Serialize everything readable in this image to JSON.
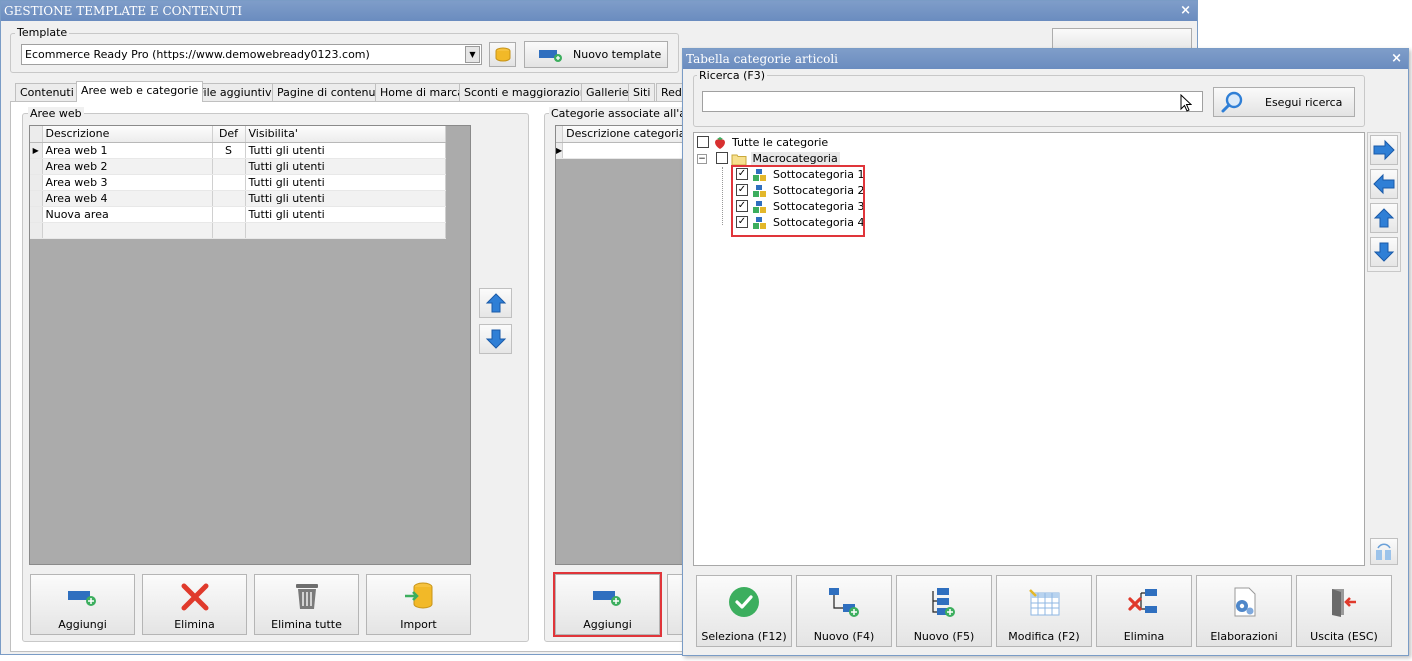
{
  "main_window": {
    "title": "GESTIONE TEMPLATE E CONTENUTI",
    "close": "×",
    "template": {
      "group_label": "Template",
      "value": "Ecommerce Ready Pro (https://www.demowebready0123.com)",
      "new_button": "Nuovo template"
    },
    "tabs": [
      "Contenuti",
      "Aree web e categorie",
      "File aggiuntivi",
      "Pagine di contenuti",
      "Home di marca",
      "Sconti e maggiorazioni",
      "Gallerie",
      "Siti",
      "Redi"
    ],
    "active_tab": "Aree web e categorie",
    "web_areas": {
      "group_label": "Aree web",
      "columns": [
        "Descrizione",
        "Def",
        "Visibilita'"
      ],
      "rows": [
        {
          "descrizione": "Area web 1",
          "def": "S",
          "visibilita": "Tutti gli utenti"
        },
        {
          "descrizione": "Area web 2",
          "def": "",
          "visibilita": "Tutti gli utenti"
        },
        {
          "descrizione": "Area web 3",
          "def": "",
          "visibilita": "Tutti gli utenti"
        },
        {
          "descrizione": "Area web 4",
          "def": "",
          "visibilita": "Tutti gli utenti"
        },
        {
          "descrizione": "Nuova area",
          "def": "",
          "visibilita": "Tutti gli utenti"
        }
      ],
      "buttons": [
        "Aggiungi",
        "Elimina",
        "Elimina tutte",
        "Import"
      ]
    },
    "categories": {
      "group_label": "Categorie associate all'area",
      "column": "Descrizione categoria",
      "add_button": "Aggiungi"
    }
  },
  "dialog": {
    "title": "Tabella categorie articoli",
    "close": "×",
    "search": {
      "group_label": "Ricerca (F3)",
      "value": "",
      "button": "Esegui ricerca"
    },
    "tree": {
      "root": "Tutte le categorie",
      "macro": "Macrocategoria",
      "expander": "−",
      "children": [
        "Sottocategoria 1",
        "Sottocategoria 2",
        "Sottocategoria 3",
        "Sottocategoria 4"
      ],
      "check_mark": "✓"
    },
    "buttons": [
      "Seleziona (F12)",
      "Nuovo (F4)",
      "Nuovo (F5)",
      "Modifica (F2)",
      "Elimina",
      "Elaborazioni",
      "Uscita (ESC)"
    ]
  },
  "colors": {
    "title_bar": "#7392c4",
    "highlight": "#e0353a",
    "arrow_blue": "#2f7fd6",
    "check_green": "#3cae5e",
    "delete_red": "#e03a2c"
  }
}
